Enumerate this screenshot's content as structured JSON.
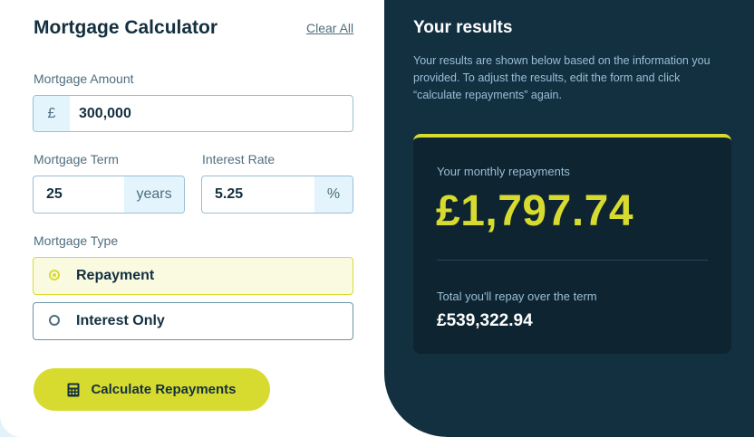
{
  "form": {
    "title": "Mortgage Calculator",
    "clear_label": "Clear All",
    "amount": {
      "label": "Mortgage Amount",
      "prefix": "£",
      "value": "300,000"
    },
    "term": {
      "label": "Mortgage Term",
      "value": "25",
      "suffix": "years"
    },
    "rate": {
      "label": "Interest Rate",
      "value": "5.25",
      "suffix": "%"
    },
    "type": {
      "label": "Mortgage Type",
      "options": [
        {
          "label": "Repayment",
          "selected": true
        },
        {
          "label": "Interest Only",
          "selected": false
        }
      ]
    },
    "submit_label": "Calculate Repayments"
  },
  "results": {
    "title": "Your results",
    "description": "Your results are shown below based on the information you provided. To adjust the results, edit the form and click “calculate repayments” again.",
    "monthly_label": "Your monthly repayments",
    "monthly_value": "£1,797.74",
    "total_label": "Total you'll repay over the term",
    "total_value": "£539,322.94"
  },
  "colors": {
    "accent": "#d8db2f",
    "dark": "#133041",
    "text": "#133040",
    "muted": "#4e6e7e"
  },
  "icons": {
    "calculator": "calculator-icon"
  }
}
